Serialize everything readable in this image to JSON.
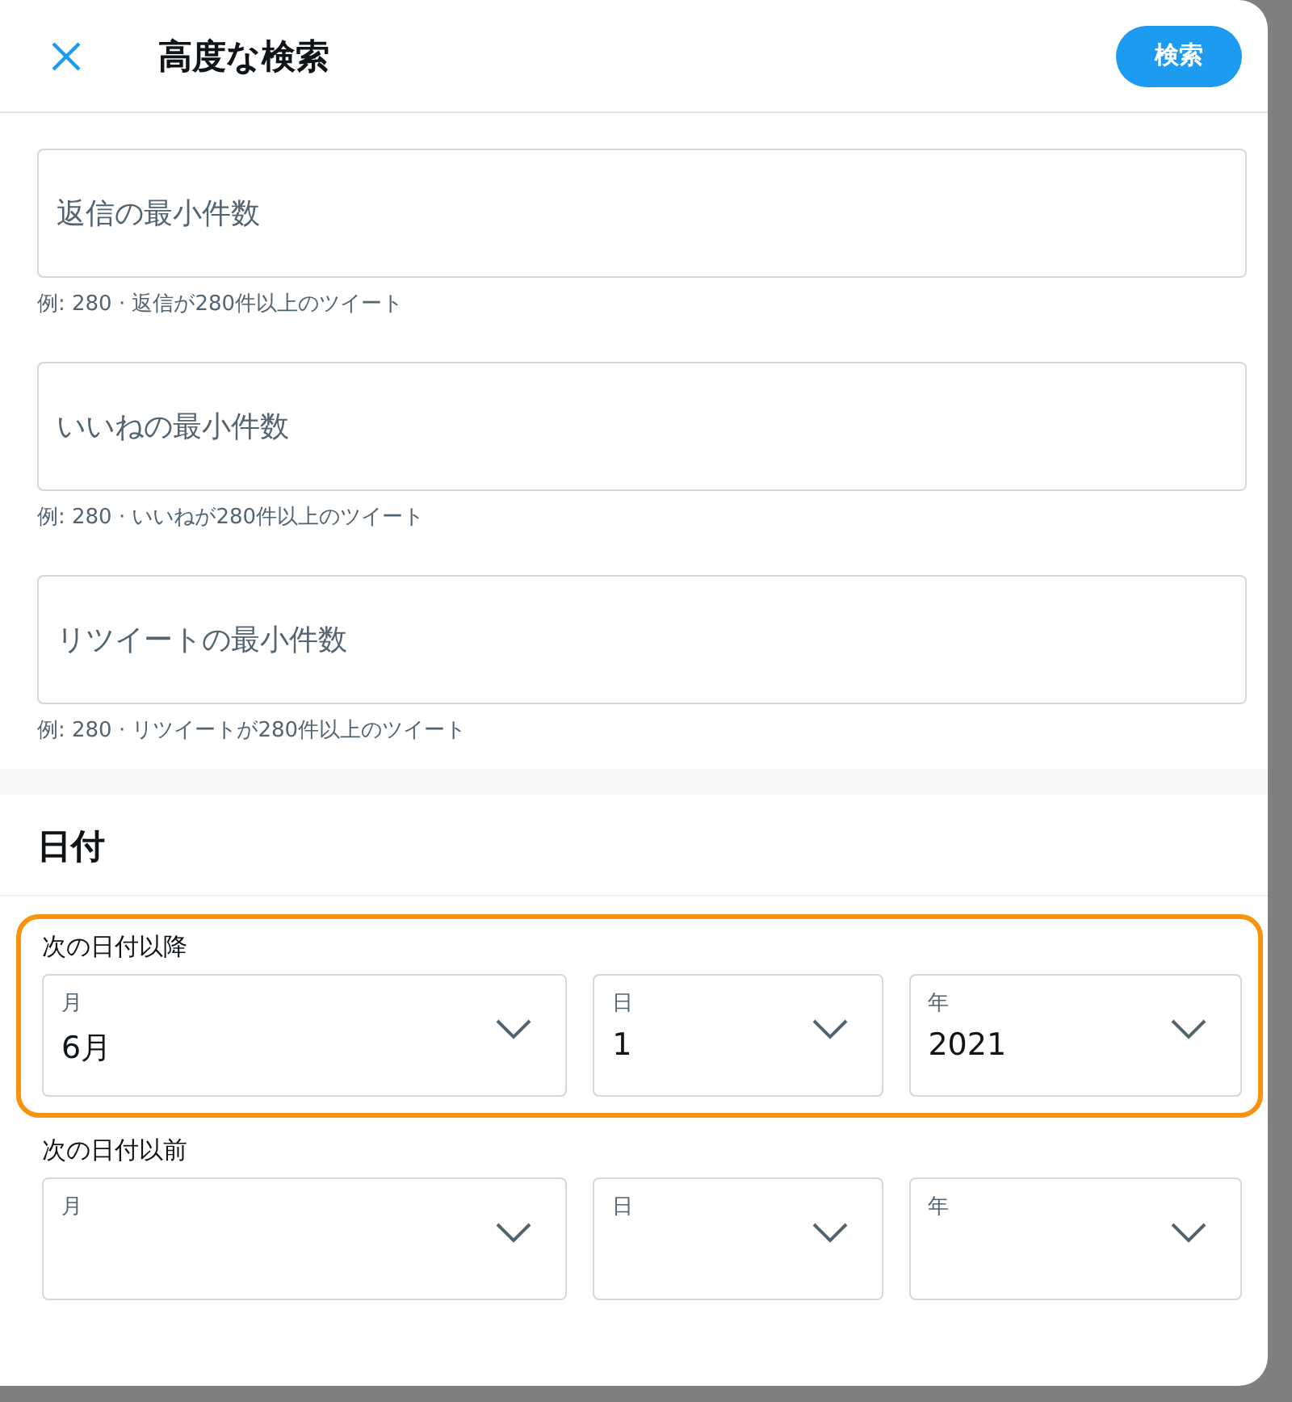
{
  "header": {
    "title": "高度な検索",
    "search_button": "検索"
  },
  "min_fields": [
    {
      "placeholder": "返信の最小件数",
      "hint": "例: 280 · 返信が280件以上のツイート"
    },
    {
      "placeholder": "いいねの最小件数",
      "hint": "例: 280 · いいねが280件以上のツイート"
    },
    {
      "placeholder": "リツイートの最小件数",
      "hint": "例: 280 · リツイートが280件以上のツイート"
    }
  ],
  "date_section": {
    "title": "日付",
    "ranges": [
      {
        "label": "次の日付以降",
        "highlighted": true,
        "selects": [
          {
            "label": "月",
            "value": "6月"
          },
          {
            "label": "日",
            "value": "1"
          },
          {
            "label": "年",
            "value": "2021"
          }
        ]
      },
      {
        "label": "次の日付以前",
        "highlighted": false,
        "selects": [
          {
            "label": "月"
          },
          {
            "label": "日"
          },
          {
            "label": "年"
          }
        ]
      }
    ]
  }
}
